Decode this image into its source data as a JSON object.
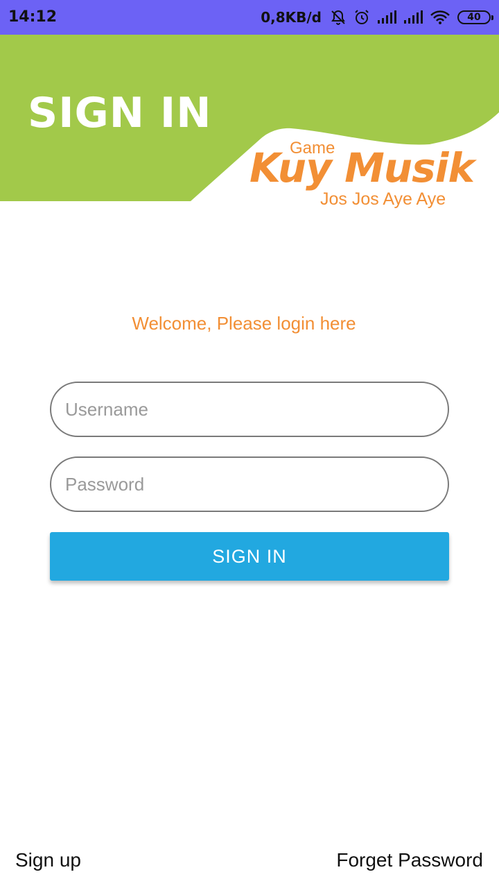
{
  "status_bar": {
    "time": "14:12",
    "network_speed": "0,8KB/d",
    "battery_level": "40",
    "icons": [
      "muted-bell-icon",
      "alarm-icon",
      "signal-icon",
      "signal-icon",
      "wifi-icon",
      "battery-icon"
    ],
    "background_color": "#6C62F5"
  },
  "header": {
    "title": "SIGN IN",
    "background_color": "#A2C94A",
    "logo": {
      "top_text": "Game",
      "main_text": "Kuy Musik",
      "tagline": "Jos Jos Aye Aye",
      "color": "#F28F35"
    }
  },
  "form": {
    "welcome_text": "Welcome, Please login here",
    "username_placeholder": "Username",
    "password_placeholder": "Password",
    "username_value": "",
    "password_value": "",
    "submit_label": "SIGN IN",
    "button_color": "#22A8E0"
  },
  "footer": {
    "sign_up_label": "Sign up",
    "forget_password_label": "Forget Password"
  }
}
